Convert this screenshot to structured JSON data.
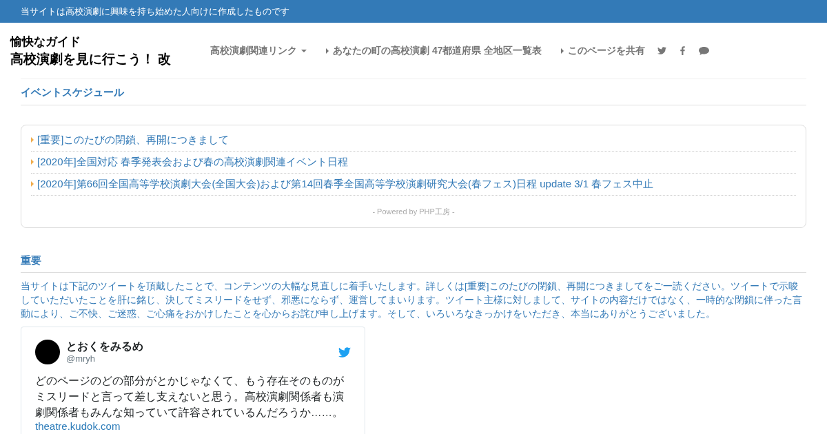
{
  "top_bar": {
    "text": "当サイトは高校演劇に興味を持ち始めた人向けに作成したものです"
  },
  "site_title": {
    "line_1": "愉快なガイド",
    "line_2": "高校演劇を見に行こう！ 改"
  },
  "nav": [
    {
      "kind": "dropdown",
      "label": "高校演劇関連リンク"
    },
    {
      "kind": "link",
      "label": "あなたの町の高校演劇 47都道府県 全地区一覧表"
    },
    {
      "kind": "link",
      "label": "このページを共有"
    }
  ],
  "schedule": {
    "heading": "イベントスケジュール",
    "items": [
      "[重要]このたびの閉鎖、再開につきまして",
      "[2020年]全国対応 春季発表会および春の高校演劇関連イベント日程",
      "[2020年]第66回全国高等学校演劇大会(全国大会)および第14回春季全国高等学校演劇研究大会(春フェス)日程 update 3/1 春フェス中止"
    ],
    "footer": "- Powered by PHP工房 -"
  },
  "notice": {
    "heading": "重要",
    "body": "当サイトは下記のツイートを頂戴したことで、コンテンツの大幅な見直しに着手いたします。詳しくは[重要]このたびの閉鎖、再開につきましてをご一読ください。ツイートで示唆していただいたことを肝に銘じ、決してミスリードをせず、邪悪にならず、運営してまいります。ツイート主様に対しまして、サイトの内容だけではなく、一時的な閉鎖に伴った言動により、ご不快、ご迷惑、ご心痛をおかけしたことを心からお詫び申し上げます。そして、いろいろなきっかけをいただき、本当にありがとうございました。"
  },
  "tweet": {
    "name": "とおくをみるめ",
    "handle": "@mryh",
    "text": "どのページのどの部分がとかじゃなくて、もう存在そのものがミスリードと言って差し支えないと思う。高校演劇関係者も演劇関係者もみんな知っていて許容されているんだろうか……。",
    "link": "theatre.kudok.com"
  }
}
